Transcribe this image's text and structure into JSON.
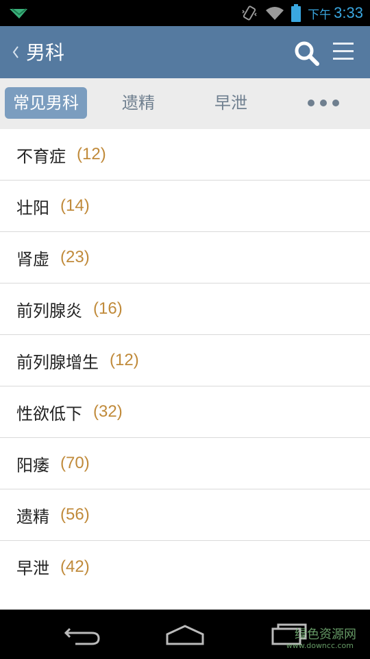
{
  "status_bar": {
    "time_label": "下午",
    "time": "3:33",
    "icons": [
      "notification-icon",
      "vibrate-icon",
      "wifi-icon",
      "battery-icon"
    ],
    "color": "#3aa7e0"
  },
  "app_bar": {
    "title": "男科",
    "back_icon": "chevron-left-icon",
    "search_icon": "search-icon",
    "menu_icon": "menu-icon",
    "color": "#557aa0"
  },
  "tabs": [
    {
      "label": "常见男科",
      "active": true
    },
    {
      "label": "遗精",
      "active": false
    },
    {
      "label": "早泄",
      "active": false
    }
  ],
  "more_icon": "more-dots-icon",
  "list": [
    {
      "label": "不育症",
      "count": "(12)"
    },
    {
      "label": "壮阳",
      "count": "(14)"
    },
    {
      "label": "肾虚",
      "count": "(23)"
    },
    {
      "label": "前列腺炎",
      "count": "(16)"
    },
    {
      "label": "前列腺增生",
      "count": "(12)"
    },
    {
      "label": "性欲低下",
      "count": "(32)"
    },
    {
      "label": "阳痿",
      "count": "(70)"
    },
    {
      "label": "遗精",
      "count": "(56)"
    },
    {
      "label": "早泄",
      "count": "(42)"
    }
  ],
  "nav_bar": {
    "buttons": [
      "back-icon",
      "home-icon",
      "recents-icon"
    ]
  },
  "watermark": {
    "text": "绿色资源网",
    "url": "www.downcc.com"
  }
}
